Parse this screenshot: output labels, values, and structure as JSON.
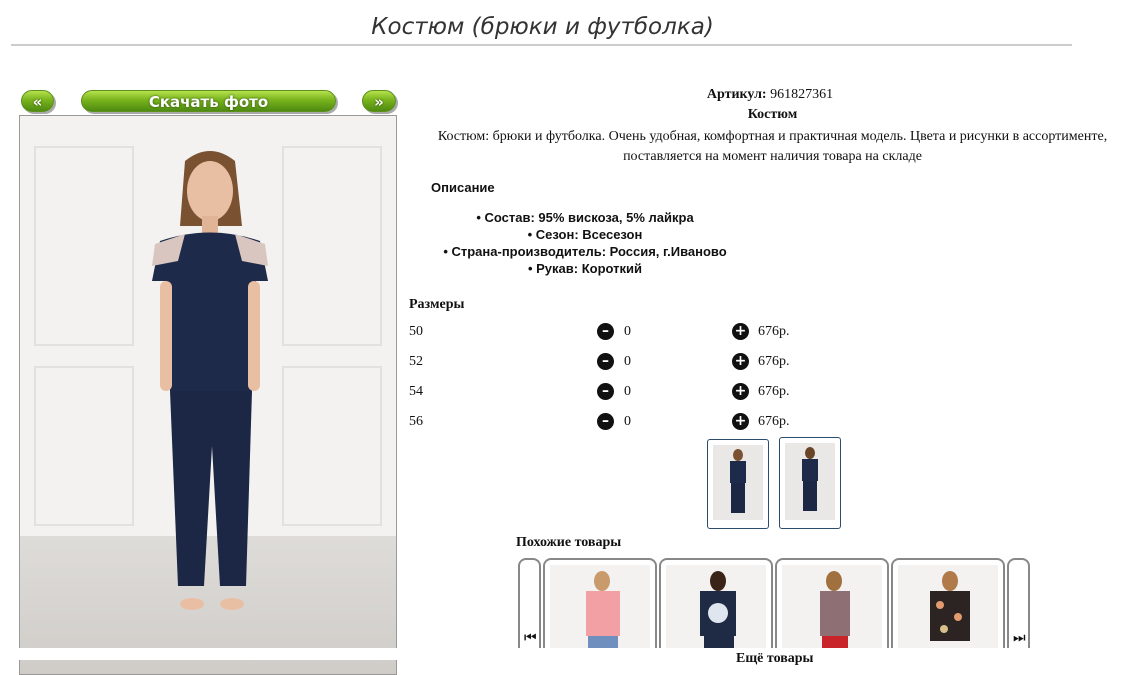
{
  "page": {
    "title": "Костюм (брюки и футболка)"
  },
  "gallery": {
    "prev_label": "«",
    "download_label": "Скачать фото",
    "next_label": "»"
  },
  "product": {
    "article_label": "Артикул:",
    "article_value": "961827361",
    "name": "Костюм",
    "description": "Костюм: брюки и футболка. Очень удобная, комфортная и практичная модель. Цвета и рисунки в ассортименте, поставляется на момент наличия товара на складе",
    "description_heading": "Описание",
    "attributes": [
      "Состав: 95% вискоза, 5% лайкра",
      "Сезон: Всесезон",
      "Страна-производитель: Россия, г.Иваново",
      "Рукав: Короткий"
    ]
  },
  "sizes": {
    "heading": "Размеры",
    "rows": [
      {
        "size": "50",
        "qty": "0",
        "price": "676р."
      },
      {
        "size": "52",
        "qty": "0",
        "price": "676р."
      },
      {
        "size": "54",
        "qty": "0",
        "price": "676р."
      },
      {
        "size": "56",
        "qty": "0",
        "price": "676р."
      }
    ]
  },
  "similar": {
    "heading": "Похожие товары",
    "more_label": "Ещё товары"
  },
  "icons": {
    "minus": "minus-circle-icon",
    "plus": "plus-circle-icon",
    "first": "first-page-icon",
    "last": "last-page-icon"
  },
  "colors": {
    "accent_green": "#79b31d",
    "thumb_border": "#2a4d6e",
    "outfit_navy": "#1d2a4a"
  }
}
